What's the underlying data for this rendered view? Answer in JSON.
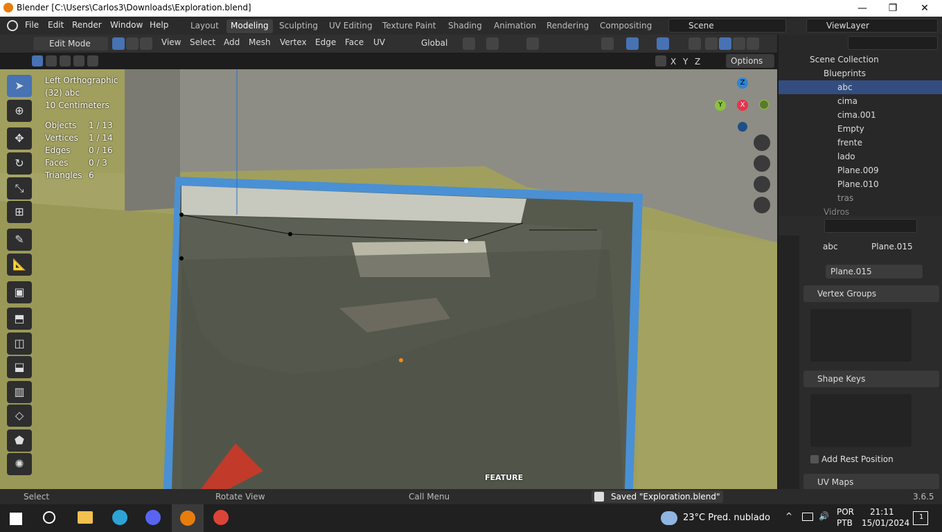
{
  "window": {
    "title": "Blender [C:\\Users\\Carlos3\\Downloads\\Exploration.blend]",
    "min": "—",
    "max": "❐",
    "close": "✕"
  },
  "menu": [
    "File",
    "Edit",
    "Render",
    "Window",
    "Help"
  ],
  "workspaces": [
    "Layout",
    "Modeling",
    "Sculpting",
    "UV Editing",
    "Texture Paint",
    "Shading",
    "Animation",
    "Rendering",
    "Compositing"
  ],
  "scene": {
    "label": "Scene",
    "view_layer": "ViewLayer"
  },
  "header": {
    "mode": "Edit Mode",
    "menus": [
      "View",
      "Select",
      "Add",
      "Mesh",
      "Vertex",
      "Edge",
      "Face",
      "UV"
    ],
    "orientation": "Global",
    "options": "Options",
    "axes": [
      "X",
      "Y",
      "Z"
    ]
  },
  "viewport": {
    "view_name": "Left Orthographic",
    "object_name": "(32) abc",
    "scale": "10 Centimeters",
    "stats": [
      {
        "label": "Objects",
        "value": "1 / 13"
      },
      {
        "label": "Vertices",
        "value": "1 / 14"
      },
      {
        "label": "Edges",
        "value": "0 / 16"
      },
      {
        "label": "Faces",
        "value": "0 / 3"
      },
      {
        "label": "Triangles",
        "value": "6"
      }
    ],
    "gizmo": {
      "z": "Z",
      "y": "Y",
      "x": "X"
    },
    "watermark": "FEATURE"
  },
  "outliner": {
    "root": "Scene Collection",
    "collection": "Blueprints",
    "items": [
      "abc",
      "cima",
      "cima.001",
      "Empty",
      "frente",
      "lado",
      "Plane.009",
      "Plane.010",
      "tras",
      "Vidros"
    ]
  },
  "properties": {
    "breadcrumb_object": "abc",
    "breadcrumb_data": "Plane.015",
    "data_name": "Plane.015",
    "vertex_groups": "Vertex Groups",
    "shape_keys": "Shape Keys",
    "add_rest_position": "Add Rest Position",
    "uv_maps": "UV Maps"
  },
  "status": {
    "select": "Select",
    "rotate": "Rotate View",
    "call_menu": "Call Menu",
    "saved": "Saved \"Exploration.blend\"",
    "version": "3.6.5"
  },
  "taskbar": {
    "weather": "23°C  Pred. nublado",
    "lang": "POR",
    "layout": "PTB",
    "time": "21:11",
    "date": "15/01/2024",
    "notifications": "1"
  },
  "colors": {
    "accent": "#4772b3",
    "x_axis": "#e8334a",
    "y_axis": "#8cc13f",
    "z_axis": "#2d86d6",
    "viewport_bg": "#9e9c5a"
  }
}
